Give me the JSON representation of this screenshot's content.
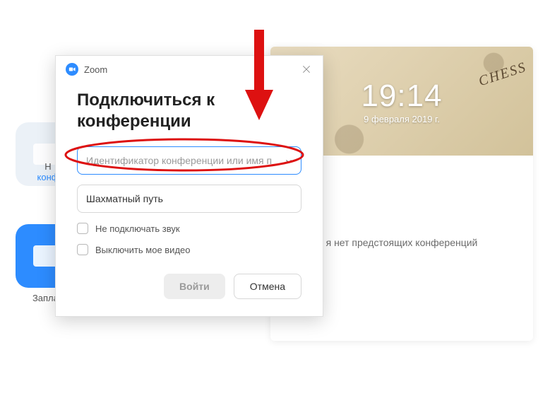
{
  "background": {
    "tile1_label_line1": "Н",
    "tile1_label_line2": "конф",
    "tile2_label": "Заплан",
    "panel": {
      "time": "19:14",
      "date": "9 февраля 2019 г.",
      "decor": "CHESS",
      "no_conf": "я нет предстоящих конференций"
    }
  },
  "modal": {
    "app_name": "Zoom",
    "heading": "Подключиться к конференции",
    "meeting_id_placeholder": "Идентификатор конференции или имя п",
    "name_value": "Шахматный путь",
    "options": {
      "no_audio": "Не подключать звук",
      "no_video": "Выключить мое видео"
    },
    "join_label": "Войти",
    "cancel_label": "Отмена"
  }
}
